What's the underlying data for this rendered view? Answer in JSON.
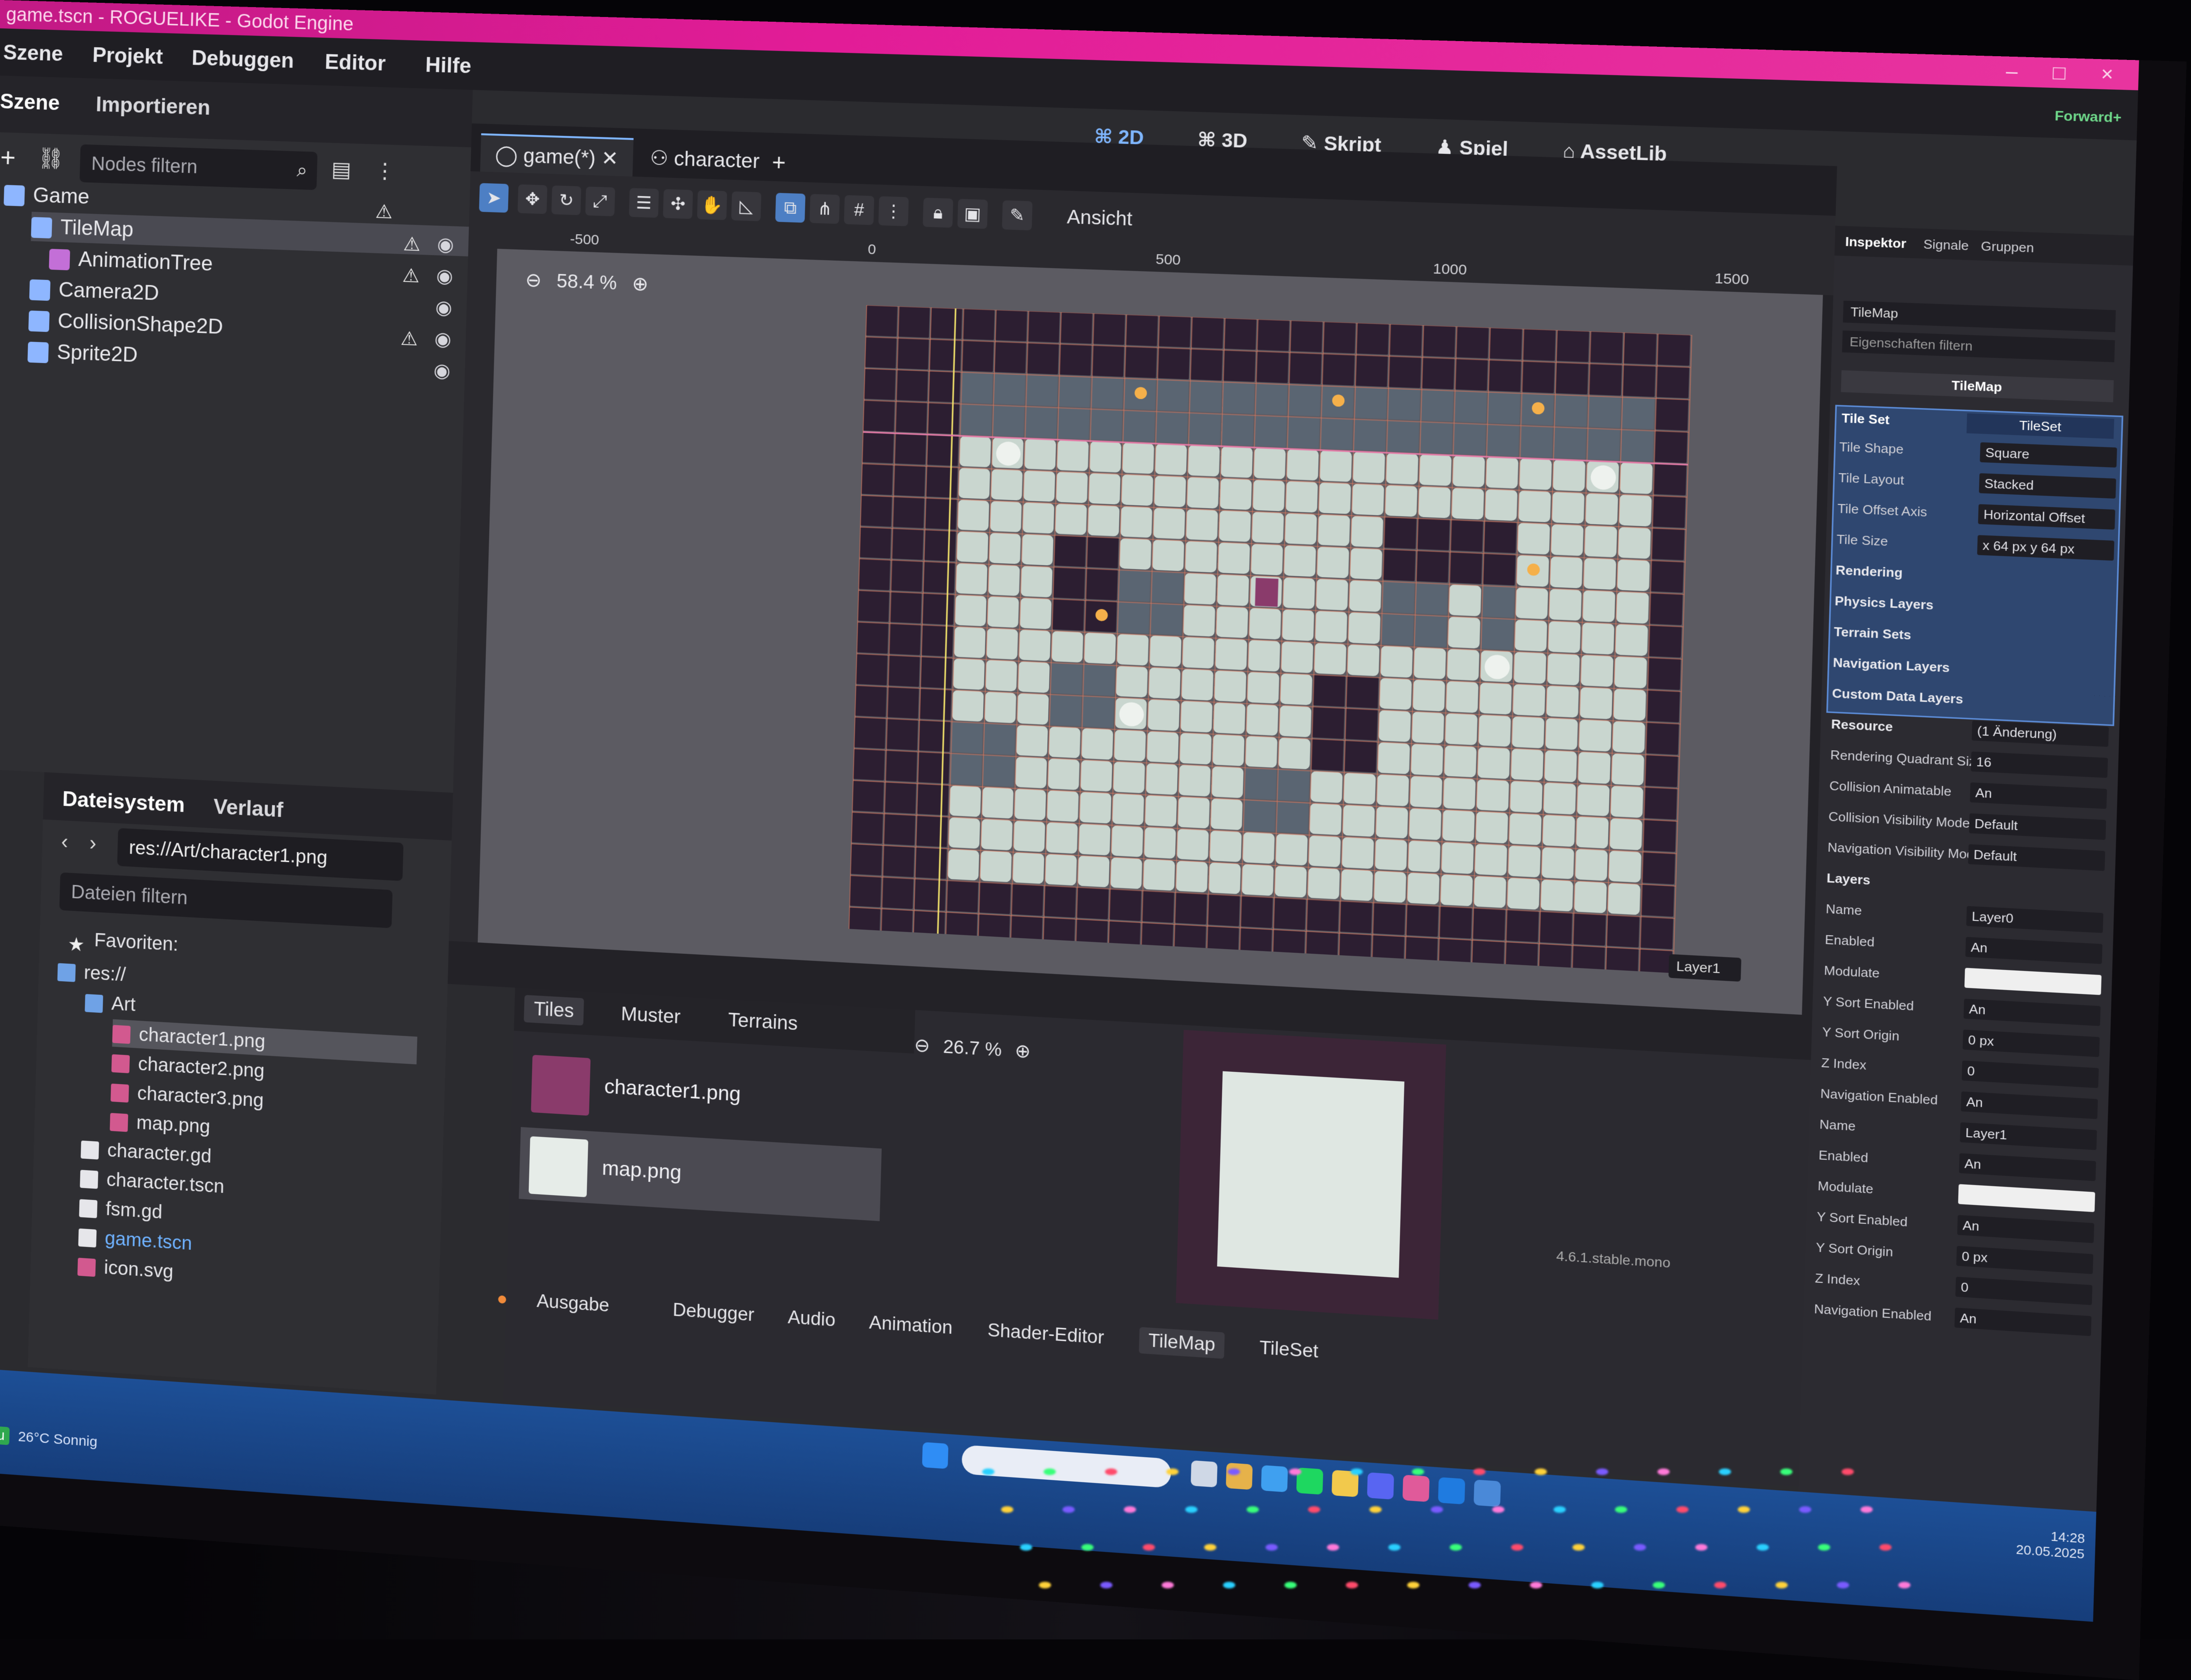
{
  "window": {
    "title": "game.tscn - ROGUELIKE - Godot Engine",
    "controls": "–  □  ×"
  },
  "menu": [
    "Szene",
    "Projekt",
    "Debuggen",
    "Editor",
    "Hilfe"
  ],
  "main_screens": [
    "2D",
    "3D",
    "Skript",
    "Spiel",
    "AssetLib"
  ],
  "renderer": "Forward+",
  "scene_dock": {
    "tabs": [
      "Szene",
      "Importieren"
    ],
    "filter_placeholder": "Nodes filtern",
    "nodes": [
      {
        "label": "Game",
        "icon": "node2d-icon",
        "color": "#8eb6ff"
      },
      {
        "label": "TileMap",
        "icon": "tilemap-icon",
        "color": "#8eb6ff",
        "selected": true
      },
      {
        "label": "AnimationTree",
        "icon": "animation-tree-icon",
        "color": "#c36fd7"
      },
      {
        "label": "Camera2D",
        "icon": "camera-icon",
        "color": "#8eb6ff"
      },
      {
        "label": "CollisionShape2D",
        "icon": "collision-shape-icon",
        "color": "#8eb6ff"
      },
      {
        "label": "Sprite2D",
        "icon": "sprite-icon",
        "color": "#8eb6ff"
      }
    ]
  },
  "filesystem_dock": {
    "tabs": [
      "Dateisystem",
      "Verlauf"
    ],
    "path": "res://Art/character1.png",
    "filter_placeholder": "Dateien filtern",
    "favorites": "Favoriten:",
    "items": [
      {
        "label": "res://",
        "kind": "folder",
        "indent": 0
      },
      {
        "label": "Art",
        "kind": "folder",
        "indent": 1
      },
      {
        "label": "character1.png",
        "kind": "image",
        "indent": 2,
        "selected": true
      },
      {
        "label": "character2.png",
        "kind": "image",
        "indent": 2
      },
      {
        "label": "character3.png",
        "kind": "image",
        "indent": 2
      },
      {
        "label": "map.png",
        "kind": "image",
        "indent": 2
      },
      {
        "label": "character.gd",
        "kind": "script",
        "indent": 1
      },
      {
        "label": "character.tscn",
        "kind": "scene",
        "indent": 1
      },
      {
        "label": "fsm.gd",
        "kind": "script",
        "indent": 1
      },
      {
        "label": "game.tscn",
        "kind": "scene",
        "indent": 1,
        "highlight": true
      },
      {
        "label": "icon.svg",
        "kind": "image",
        "indent": 1
      }
    ]
  },
  "editor_tabs": [
    {
      "label": "game(*)",
      "active": true
    },
    {
      "label": "character",
      "active": false
    }
  ],
  "viewport": {
    "toolbar_menu": "Ansicht",
    "zoom": "58.4 %",
    "ruler_labels": [
      "-500",
      "0",
      "500",
      "1000",
      "1500"
    ],
    "layer_select": "Layer1"
  },
  "tilemap_panel": {
    "tabs": [
      "Tiles",
      "Muster",
      "Terrains"
    ],
    "sources": [
      {
        "label": "character1.png",
        "color": "#8a3b6b"
      },
      {
        "label": "map.png",
        "color": "#e6ece8",
        "selected": true
      }
    ],
    "zoom": "26.7 %",
    "version": "4.6.1.stable.mono"
  },
  "bottom_tabs": [
    "Ausgabe",
    "Debugger",
    "Audio",
    "Animation",
    "Shader-Editor",
    "TileMap",
    "TileSet"
  ],
  "inspector": {
    "tabs": [
      "Inspektor",
      "Signale",
      "Gruppen"
    ],
    "object": "TileMap",
    "filter_placeholder": "Eigenschaften filtern",
    "class_header": "TileMap",
    "tile_set_label": "Tile Set",
    "tile_set_value": "TileSet",
    "properties": [
      {
        "k": "Tile Shape",
        "v": "Square"
      },
      {
        "k": "Tile Layout",
        "v": "Stacked"
      },
      {
        "k": "Tile Offset Axis",
        "v": "Horizontal Offset"
      },
      {
        "k": "Tile Size",
        "v": "x 64 px   y 64 px"
      },
      {
        "k": "Rendering",
        "v": ""
      },
      {
        "k": "Physics Layers",
        "v": ""
      },
      {
        "k": "Terrain Sets",
        "v": ""
      },
      {
        "k": "Navigation Layers",
        "v": ""
      },
      {
        "k": "Custom Data Layers",
        "v": ""
      },
      {
        "k": "Resource",
        "v": "(1 Änderung)"
      },
      {
        "k": "Rendering Quadrant Size",
        "v": "16"
      },
      {
        "k": "Collision Animatable",
        "v": "An"
      },
      {
        "k": "Collision Visibility Mode",
        "v": "Default"
      },
      {
        "k": "Navigation Visibility Mode",
        "v": "Default"
      },
      {
        "k": "Layers",
        "v": ""
      },
      {
        "k": "Name",
        "v": "Layer0"
      },
      {
        "k": "Enabled",
        "v": "An"
      },
      {
        "k": "Modulate",
        "v": ""
      },
      {
        "k": "Y Sort Enabled",
        "v": "An"
      },
      {
        "k": "Y Sort Origin",
        "v": "0 px"
      },
      {
        "k": "Z Index",
        "v": "0"
      },
      {
        "k": "Navigation Enabled",
        "v": "An"
      },
      {
        "k": "Name",
        "v": "Layer1"
      },
      {
        "k": "Enabled",
        "v": "An"
      },
      {
        "k": "Modulate",
        "v": ""
      },
      {
        "k": "Y Sort Enabled",
        "v": "An"
      },
      {
        "k": "Y Sort Origin",
        "v": "0 px"
      },
      {
        "k": "Z Index",
        "v": "0"
      },
      {
        "k": "Navigation Enabled",
        "v": "An"
      }
    ]
  },
  "taskbar": {
    "weather_temp": "26°C",
    "weather_text": "Sonnig",
    "badge": "Neu",
    "time": "14:28",
    "date": "20.05.2025"
  },
  "colors": {
    "accent": "#4d7fc4",
    "titlebar": "#e21c97",
    "floor": "#c9d6cf",
    "wall": "#2c1e31",
    "brick": "#5a6572"
  }
}
